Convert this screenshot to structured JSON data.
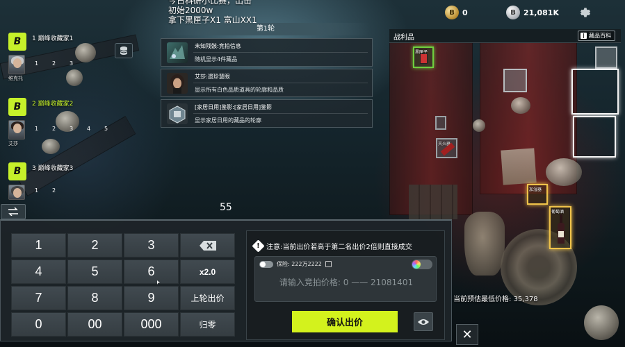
{
  "top_info": {
    "lines": [
      "今日科研小比赛，出击",
      "初始2000w",
      "拿下黑匣子X1 富山XX1"
    ]
  },
  "currencies": [
    {
      "icon": "gold-coin-icon",
      "value": "0"
    },
    {
      "icon": "silver-coin-icon",
      "value": "21,081K"
    }
  ],
  "round_label": "第1轮",
  "players": [
    {
      "rank": "1",
      "name": "巅峰收藏家1",
      "avatar_name": "维克托",
      "slots": [
        "1",
        "2",
        "3"
      ],
      "active": false
    },
    {
      "rank": "2",
      "name": "巅峰收藏家2",
      "avatar_name": "艾莎",
      "slots": [
        "1",
        "2",
        "3",
        "4",
        "5"
      ],
      "active": true
    },
    {
      "rank": "3",
      "name": "巅峰收藏家3",
      "avatar_name": "",
      "slots": [
        "1",
        "2"
      ],
      "active": false
    }
  ],
  "info_cards": [
    {
      "title": "未知残骸:竞拍信息",
      "subtitle": "随机显示4件藏品",
      "icon": "debris-icon"
    },
    {
      "title": "艾莎:遗珍慧眼",
      "subtitle": "显示所有白色品质道具的轮廓和品质",
      "icon": "aisha-portrait"
    },
    {
      "title": "[家居日用]鉴影:[家居日用]鉴影",
      "subtitle": "显示家居日用的藏品的轮廓",
      "icon": "home-goods-icon"
    }
  ],
  "loot_panel": {
    "title": "战利品",
    "encyclopedia_label": "藏品百科",
    "item_labels": [
      "黑匣子",
      "灭火器",
      "加湿器",
      "葡萄酒"
    ],
    "estimate_label": "当前预估最低价格:",
    "estimate_value": "35,378"
  },
  "timer": "55",
  "keypad": {
    "keys": [
      "1",
      "2",
      "3",
      "4",
      "5",
      "6",
      "7",
      "8",
      "9",
      "0",
      "00",
      "000"
    ],
    "backspace_icon": "backspace-icon",
    "multiplier": "x2.0",
    "last_round": "上轮出价",
    "reset": "归零"
  },
  "bid_box": {
    "notice": "注意:当前出价若高于第二名出价2倍则直接成交",
    "insurance_label": "保险: 222万2222",
    "placeholder": "请输入竞拍价格: 0 —— 21081401",
    "confirm_label": "确认出价"
  },
  "colors": {
    "accent": "#d3f21d",
    "green_frame": "#6fcf3e",
    "gold_frame": "#f0c34a"
  }
}
